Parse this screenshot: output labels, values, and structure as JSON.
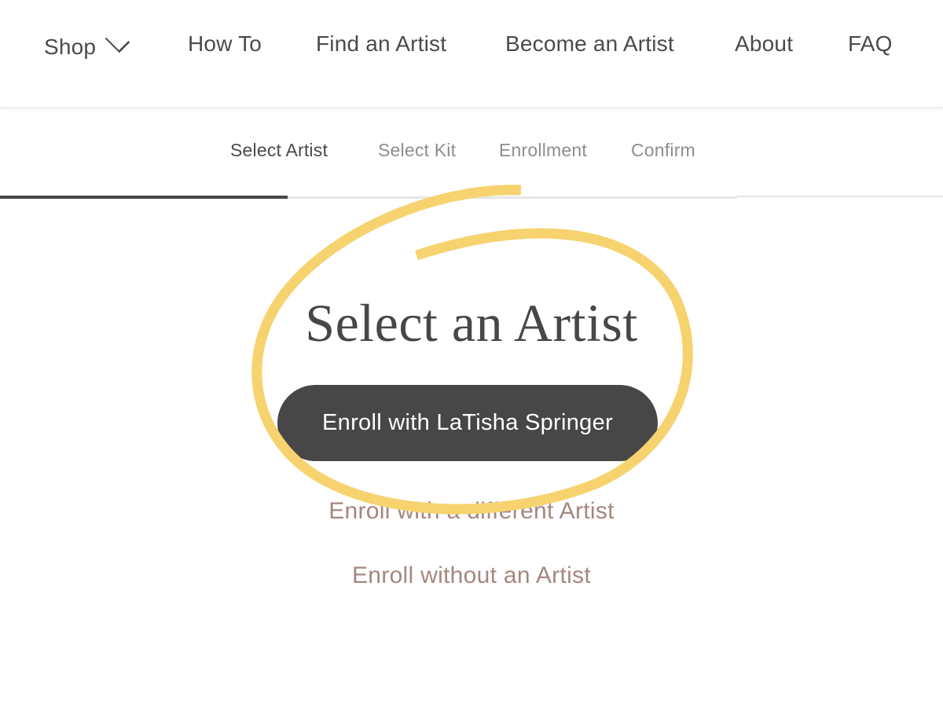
{
  "nav": {
    "items": [
      {
        "label": "Shop",
        "has_dropdown": true,
        "icon": "chevron-down-icon"
      },
      {
        "label": "How To"
      },
      {
        "label": "Find an Artist"
      },
      {
        "label": "Become an Artist"
      },
      {
        "label": "About"
      },
      {
        "label": "FAQ"
      }
    ]
  },
  "steps": {
    "items": [
      {
        "label": "Select Artist",
        "active": true
      },
      {
        "label": "Select Kit",
        "active": false
      },
      {
        "label": "Enrollment",
        "active": false
      },
      {
        "label": "Confirm",
        "active": false
      }
    ],
    "progress_fraction": 0.39
  },
  "main": {
    "title": "Select an Artist",
    "primary_button": "Enroll with LaTisha Springer",
    "links": [
      "Enroll with a different Artist",
      "Enroll without an Artist"
    ]
  },
  "colors": {
    "text_dark": "#4a4a4a",
    "button_bg": "#474747",
    "link": "#a4877e",
    "annotation": "#f6d36f",
    "step_inactive": "#8e8e8e"
  },
  "annotation": {
    "shape": "hand-drawn-ellipse",
    "highlights": "Enroll with LaTisha Springer"
  }
}
